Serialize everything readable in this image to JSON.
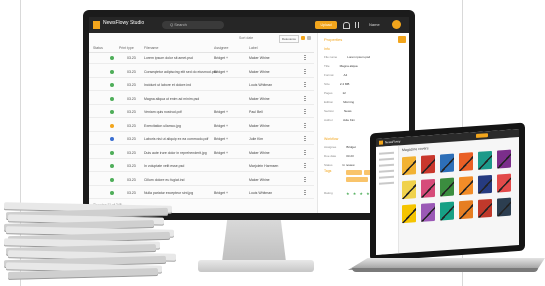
{
  "monitor_app": {
    "logo_text": "NewsFlowy Studio",
    "search_placeholder": "Q Search",
    "upload_label": "Upload",
    "user_name": "Name",
    "toolbar": {
      "sort_label": "Sort date",
      "filter_label": "Relevance"
    },
    "columns": [
      "Status",
      "Print type",
      "Filename",
      "Assignee",
      "Label"
    ],
    "rows": [
      {
        "status_color": "#4fae5a",
        "print": "03.23",
        "file": "Lorem ipsum dolor sit amet.psd",
        "assignee": "Bridget +",
        "label": "Maker Whine"
      },
      {
        "status_color": "#4fae5a",
        "print": "03.23",
        "file": "Conseqtetur adipiscing elit sed do eiusmod.psd",
        "assignee": "Bridget +",
        "label": "Maker Whine"
      },
      {
        "status_color": "#4fae5a",
        "print": "03.23",
        "file": "Incidunt ut labore et dolore.ind",
        "assignee": "",
        "label": "Louis Whitman"
      },
      {
        "status_color": "#4fae5a",
        "print": "03.23",
        "file": "Magna aliqua ut enim ad minim.psd",
        "assignee": "",
        "label": "Maker Whine"
      },
      {
        "status_color": "#4fae5a",
        "print": "03.23",
        "file": "Veniam quis nostrud.pdf",
        "assignee": "Bridget +",
        "label": "Paul Bell"
      },
      {
        "status_color": "#f2a51c",
        "print": "03.23",
        "file": "Exercitation ullamco.jpg",
        "assignee": "Bridget +",
        "label": "Maker Whine"
      },
      {
        "status_color": "#3b6fd1",
        "print": "03.23",
        "file": "Laboris nisi ut aliquip ex ea commodo.pdf",
        "assignee": "Bridget +",
        "label": "Julie Kim"
      },
      {
        "status_color": "#4fae5a",
        "print": "03.23",
        "file": "Duis aute irure dolor in reprehenderit.jpg",
        "assignee": "Bridget +",
        "label": "Maker Whine"
      },
      {
        "status_color": "#4fae5a",
        "print": "03.23",
        "file": "In voluptate velit esse.psd",
        "assignee": "",
        "label": "Marjolein Harmsen"
      },
      {
        "status_color": "#4fae5a",
        "print": "03.23",
        "file": "Cillum dolore eu fugiat.ind",
        "assignee": "",
        "label": "Maker Whine"
      },
      {
        "status_color": "#4fae5a",
        "print": "03.23",
        "file": "Nulla pariatur excepteur sint.jpg",
        "assignee": "Bridget +",
        "label": "Louis Whitman"
      }
    ],
    "footer": "Showing 11 of 245",
    "panel": {
      "title": "Properties",
      "section1": "Info",
      "kv": [
        {
          "k": "File name",
          "v": "Lorem ipsum.psd"
        },
        {
          "k": "Title",
          "v": "Magna aliqua"
        },
        {
          "k": "Format",
          "v": "A4"
        },
        {
          "k": "Size",
          "v": "2.4 MB"
        },
        {
          "k": "Pages",
          "v": "12"
        },
        {
          "k": "Edition",
          "v": "Morning"
        },
        {
          "k": "Section",
          "v": "News"
        },
        {
          "k": "Author",
          "v": "Julie Kim"
        }
      ],
      "section2": "Workflow",
      "kv2": [
        {
          "k": "Assignee",
          "v": "Bridget"
        },
        {
          "k": "Due date",
          "v": "03.23"
        },
        {
          "k": "Status",
          "v": "In review"
        }
      ],
      "section3": "Tags",
      "rating_label": "Rating",
      "stars": "★ ★ ★ ★"
    }
  },
  "laptop_app": {
    "logo_text": "NewsFlowy",
    "title": "Magazine covers",
    "thumb_colors": [
      "#f2b233",
      "#c9372c",
      "#2d6fb8",
      "#e95f25",
      "#1c9a8a",
      "#7b2e8b",
      "#f0d24c",
      "#d64b7a",
      "#3b8d3f",
      "#f28c28",
      "#263b80",
      "#e24a4a",
      "#f5c400",
      "#9b59b6",
      "#16a085",
      "#e67e22",
      "#c0392b",
      "#2c3e50"
    ]
  }
}
